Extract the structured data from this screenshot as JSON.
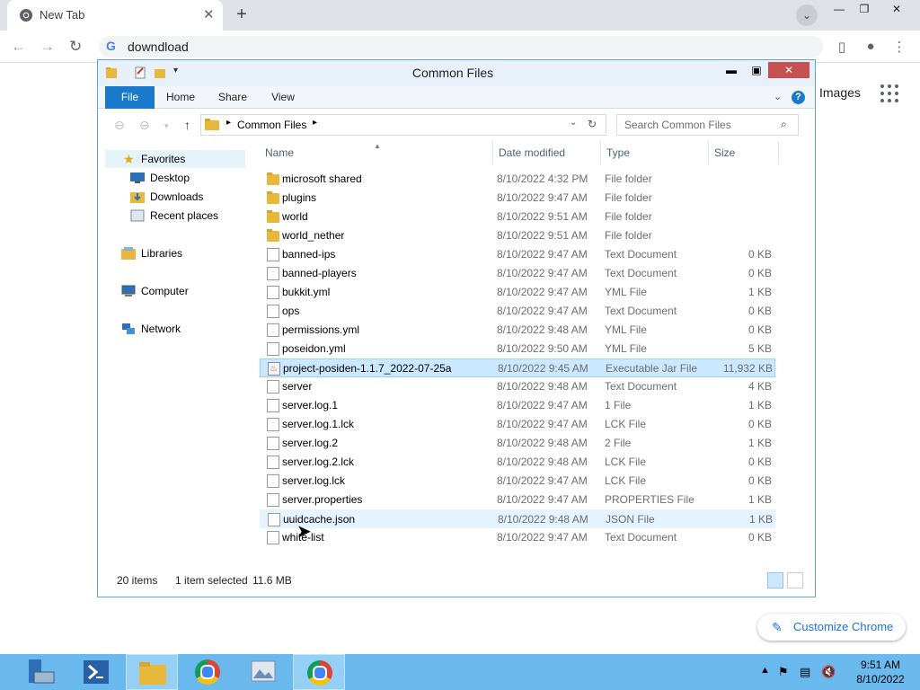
{
  "chrome": {
    "tab_title": "New Tab",
    "close_glyph": "✕",
    "newtab_glyph": "+",
    "tab_search_glyph": "⌄",
    "win_min": "—",
    "win_max": "❐",
    "win_close": "✕",
    "back_glyph": "←",
    "forward_glyph": "→",
    "reload_glyph": "↻",
    "omnibox_value": "downdload",
    "google_g": "G",
    "images_label": "Images",
    "customize_label": "Customize Chrome",
    "pen_glyph": "✎"
  },
  "explorer": {
    "title": "Common Files",
    "ribbon_tabs": [
      "File",
      "Home",
      "Share",
      "View"
    ],
    "address": "Common Files",
    "search_placeholder": "Search Common Files",
    "search_glyph": "⌕",
    "help_glyph": "?",
    "nav": {
      "favorites": "Favorites",
      "desktop": "Desktop",
      "downloads": "Downloads",
      "recent": "Recent places",
      "libraries": "Libraries",
      "computer": "Computer",
      "network": "Network"
    },
    "columns": {
      "name": "Name",
      "date": "Date modified",
      "type": "Type",
      "size": "Size"
    },
    "files": [
      {
        "name": "microsoft shared",
        "date": "8/10/2022 4:32 PM",
        "type": "File folder",
        "size": "",
        "icon": "folder"
      },
      {
        "name": "plugins",
        "date": "8/10/2022 9:47 AM",
        "type": "File folder",
        "size": "",
        "icon": "folder"
      },
      {
        "name": "world",
        "date": "8/10/2022 9:51 AM",
        "type": "File folder",
        "size": "",
        "icon": "folder"
      },
      {
        "name": "world_nether",
        "date": "8/10/2022 9:51 AM",
        "type": "File folder",
        "size": "",
        "icon": "folder"
      },
      {
        "name": "banned-ips",
        "date": "8/10/2022 9:47 AM",
        "type": "Text Document",
        "size": "0 KB",
        "icon": "doc"
      },
      {
        "name": "banned-players",
        "date": "8/10/2022 9:47 AM",
        "type": "Text Document",
        "size": "0 KB",
        "icon": "doc"
      },
      {
        "name": "bukkit.yml",
        "date": "8/10/2022 9:47 AM",
        "type": "YML File",
        "size": "1 KB",
        "icon": "doc"
      },
      {
        "name": "ops",
        "date": "8/10/2022 9:47 AM",
        "type": "Text Document",
        "size": "0 KB",
        "icon": "doc"
      },
      {
        "name": "permissions.yml",
        "date": "8/10/2022 9:48 AM",
        "type": "YML File",
        "size": "0 KB",
        "icon": "doc"
      },
      {
        "name": "poseidon.yml",
        "date": "8/10/2022 9:50 AM",
        "type": "YML File",
        "size": "5 KB",
        "icon": "doc"
      },
      {
        "name": "project-posiden-1.1.7_2022-07-25a",
        "date": "8/10/2022 9:45 AM",
        "type": "Executable Jar File",
        "size": "11,932 KB",
        "icon": "jar"
      },
      {
        "name": "server",
        "date": "8/10/2022 9:48 AM",
        "type": "Text Document",
        "size": "4 KB",
        "icon": "doc"
      },
      {
        "name": "server.log.1",
        "date": "8/10/2022 9:47 AM",
        "type": "1 File",
        "size": "1 KB",
        "icon": "doc"
      },
      {
        "name": "server.log.1.lck",
        "date": "8/10/2022 9:47 AM",
        "type": "LCK File",
        "size": "0 KB",
        "icon": "doc"
      },
      {
        "name": "server.log.2",
        "date": "8/10/2022 9:48 AM",
        "type": "2 File",
        "size": "1 KB",
        "icon": "doc"
      },
      {
        "name": "server.log.2.lck",
        "date": "8/10/2022 9:48 AM",
        "type": "LCK File",
        "size": "0 KB",
        "icon": "doc"
      },
      {
        "name": "server.log.lck",
        "date": "8/10/2022 9:47 AM",
        "type": "LCK File",
        "size": "0 KB",
        "icon": "doc"
      },
      {
        "name": "server.properties",
        "date": "8/10/2022 9:47 AM",
        "type": "PROPERTIES File",
        "size": "1 KB",
        "icon": "doc"
      },
      {
        "name": "uuidcache.json",
        "date": "8/10/2022 9:48 AM",
        "type": "JSON File",
        "size": "1 KB",
        "icon": "doc"
      },
      {
        "name": "white-list",
        "date": "8/10/2022 9:47 AM",
        "type": "Text Document",
        "size": "0 KB",
        "icon": "doc"
      }
    ],
    "selected_row": "project-posiden-1.1.7_2022-07-25a",
    "hover_row": "uuidcache.json",
    "status": {
      "count": "20 items",
      "selected": "1 item selected",
      "size": "11.6 MB"
    }
  },
  "taskbar": {
    "time": "9:51 AM",
    "date": "8/10/2022"
  },
  "colors": {
    "explorer_border": "#5ea4d8",
    "file_tab": "#1979ca",
    "selection": "#cce8ff",
    "taskbar": "#69b9ee",
    "close_button": "#c75050"
  }
}
